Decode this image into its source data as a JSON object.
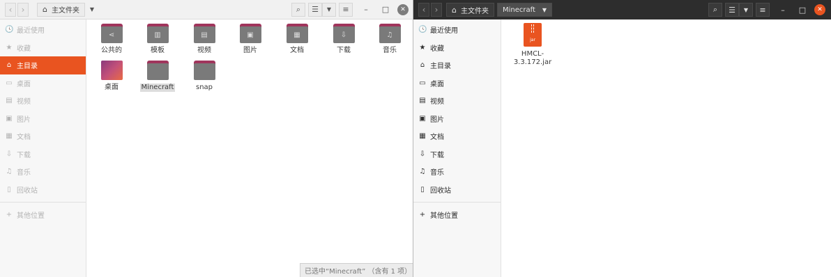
{
  "left_window": {
    "breadcrumb": {
      "home_label": "主文件夹"
    },
    "sidebar": [
      {
        "icon": "clock-icon",
        "glyph": "🕓",
        "label": "最近使用"
      },
      {
        "icon": "star-icon",
        "glyph": "★",
        "label": "收藏"
      },
      {
        "icon": "home-icon",
        "glyph": "⌂",
        "label": "主目录",
        "active": true
      },
      {
        "icon": "desktop-icon",
        "glyph": "▭",
        "label": "桌面"
      },
      {
        "icon": "video-icon",
        "glyph": "▤",
        "label": "视频"
      },
      {
        "icon": "image-icon",
        "glyph": "▣",
        "label": "图片"
      },
      {
        "icon": "document-icon",
        "glyph": "▦",
        "label": "文档"
      },
      {
        "icon": "download-icon",
        "glyph": "⇩",
        "label": "下载"
      },
      {
        "icon": "music-icon",
        "glyph": "♫",
        "label": "音乐"
      },
      {
        "icon": "trash-icon",
        "glyph": "▯",
        "label": "回收站"
      },
      {
        "icon": "plus-icon",
        "glyph": "+",
        "label": "其他位置"
      }
    ],
    "files": [
      {
        "label": "公共的",
        "glyph": "⋖",
        "icon": "share-folder-icon"
      },
      {
        "label": "模板",
        "glyph": "▥",
        "icon": "template-folder-icon"
      },
      {
        "label": "视频",
        "glyph": "▤",
        "icon": "video-folder-icon"
      },
      {
        "label": "图片",
        "glyph": "▣",
        "icon": "image-folder-icon"
      },
      {
        "label": "文档",
        "glyph": "▦",
        "icon": "document-folder-icon"
      },
      {
        "label": "下载",
        "glyph": "⇩",
        "icon": "download-folder-icon"
      },
      {
        "label": "音乐",
        "glyph": "♫",
        "icon": "music-folder-icon"
      },
      {
        "label": "桌面",
        "glyph": "",
        "icon": "desktop-folder-icon"
      },
      {
        "label": "Minecraft",
        "glyph": "",
        "icon": "folder-icon",
        "selected": true
      },
      {
        "label": "snap",
        "glyph": "",
        "icon": "folder-icon"
      }
    ],
    "status": "已选中“Minecraft” （含有 1 项）"
  },
  "right_window": {
    "breadcrumb": {
      "home_label": "主文件夹",
      "current_label": "Minecraft"
    },
    "sidebar": [
      {
        "icon": "clock-icon",
        "glyph": "🕓",
        "label": "最近使用"
      },
      {
        "icon": "star-icon",
        "glyph": "★",
        "label": "收藏"
      },
      {
        "icon": "home-icon",
        "glyph": "⌂",
        "label": "主目录"
      },
      {
        "icon": "desktop-icon",
        "glyph": "▭",
        "label": "桌面"
      },
      {
        "icon": "video-icon",
        "glyph": "▤",
        "label": "视频"
      },
      {
        "icon": "image-icon",
        "glyph": "▣",
        "label": "图片"
      },
      {
        "icon": "document-icon",
        "glyph": "▦",
        "label": "文档"
      },
      {
        "icon": "download-icon",
        "glyph": "⇩",
        "label": "下载"
      },
      {
        "icon": "music-icon",
        "glyph": "♫",
        "label": "音乐"
      },
      {
        "icon": "trash-icon",
        "glyph": "▯",
        "label": "回收站"
      },
      {
        "icon": "plus-icon",
        "glyph": "+",
        "label": "其他位置"
      }
    ],
    "files": [
      {
        "label_line1": "HMCL-",
        "label_line2": "3.3.172.jar",
        "icon_text": "jar",
        "icon": "jar-file-icon"
      }
    ]
  },
  "colors": {
    "accent": "#e95420",
    "folder_tab": "#a0355c",
    "folder_body": "#7a7a7a",
    "dark_header": "#2d2d2d"
  }
}
